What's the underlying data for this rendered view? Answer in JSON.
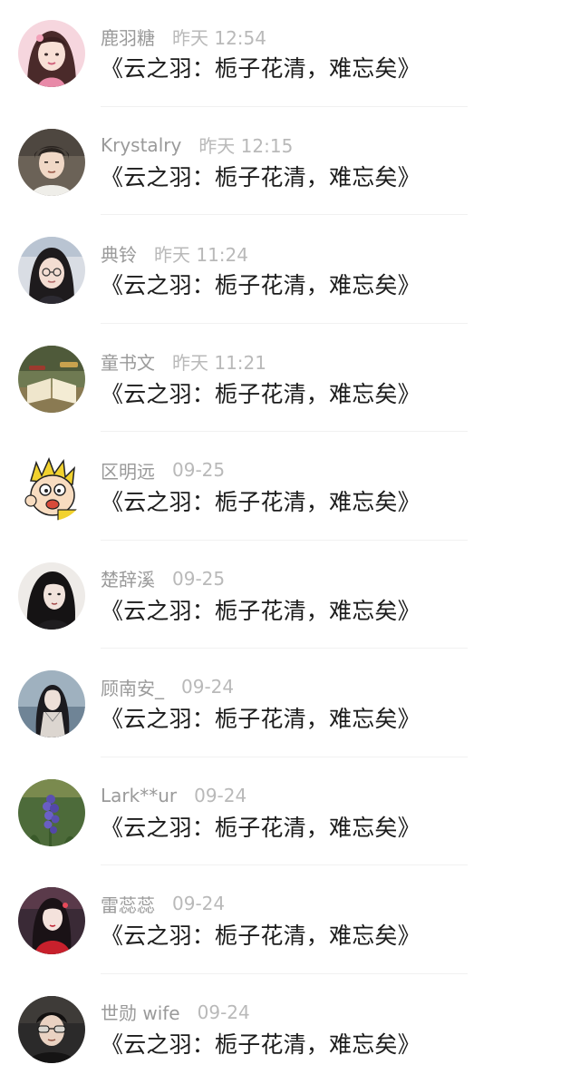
{
  "comments": [
    {
      "username": "鹿羽糖",
      "time": "昨天 12:54",
      "text": "《云之羽：栀子花清，难忘矣》",
      "avatar": "avatar-girl-pink"
    },
    {
      "username": "Krystalry",
      "time": "昨天 12:15",
      "text": "《云之羽：栀子花清，难忘矣》",
      "avatar": "avatar-boy-selfie"
    },
    {
      "username": "典铃",
      "time": "昨天 11:24",
      "text": "《云之羽：栀子花清，难忘矣》",
      "avatar": "avatar-girl-glasses"
    },
    {
      "username": "童书文",
      "time": "昨天 11:21",
      "text": "《云之羽：栀子花清，难忘矣》",
      "avatar": "avatar-open-book"
    },
    {
      "username": "区明远",
      "time": "09-25",
      "text": "《云之羽：栀子花清，难忘矣》",
      "avatar": "avatar-cartoon"
    },
    {
      "username": "楚辞溪",
      "time": "09-25",
      "text": "《云之羽：栀子花清，难忘矣》",
      "avatar": "avatar-dark-hair-girl"
    },
    {
      "username": "顾南安_",
      "time": "09-24",
      "text": "《云之羽：栀子花清，难忘矣》",
      "avatar": "avatar-girl-by-water"
    },
    {
      "username": "Lark**ur",
      "time": "09-24",
      "text": "《云之羽：栀子花清，难忘矣》",
      "avatar": "avatar-purple-flowers"
    },
    {
      "username": "雷蕊蕊",
      "time": "09-24",
      "text": "《云之羽：栀子花清，难忘矣》",
      "avatar": "avatar-girl-red-dress"
    },
    {
      "username": "世勋 wife",
      "time": "09-24",
      "text": "《云之羽：栀子花清，难忘矣》",
      "avatar": "avatar-man-sunglasses"
    }
  ],
  "colors": {
    "username": "#9a9a9a",
    "time": "#b9b9b9",
    "text": "#1c1c1c",
    "divider": "#f1f1f1"
  }
}
